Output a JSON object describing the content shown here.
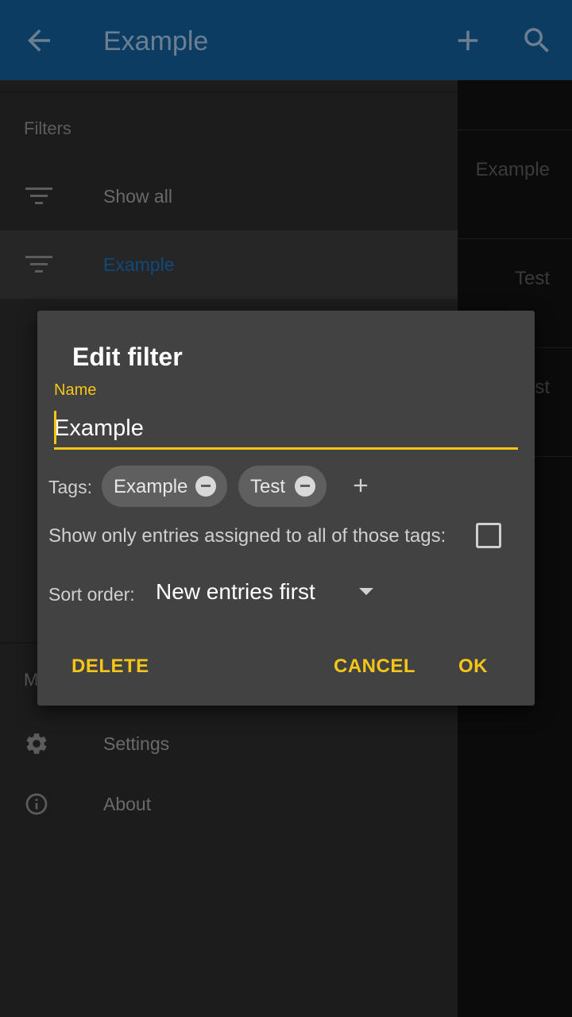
{
  "appbar": {
    "title": "Example",
    "back_icon": "arrow-back-icon",
    "add_icon": "plus-icon",
    "search_icon": "search-icon",
    "color": "#0d3c63"
  },
  "list": {
    "items": [
      "Example",
      "Test"
    ]
  },
  "drawer": {
    "filters_header": "Filters",
    "filters": [
      {
        "label": "Show all",
        "icon": "filter-icon"
      },
      {
        "label": "Example",
        "icon": "filter-icon",
        "active": true
      }
    ],
    "more_header": "M",
    "more": [
      {
        "label": "Settings",
        "icon": "gear-icon"
      },
      {
        "label": "About",
        "icon": "info-icon"
      }
    ]
  },
  "dialog": {
    "title": "Edit filter",
    "name_label": "Name",
    "name_value": "Example",
    "tags_label": "Tags:",
    "tags": [
      "Example",
      "Test"
    ],
    "show_only_label": "Show only entries assigned to all of those tags:",
    "show_only_checked": false,
    "sort_label": "Sort order:",
    "sort_value": "New entries first",
    "delete_label": "DELETE",
    "cancel_label": "CANCEL",
    "ok_label": "OK",
    "accent": "#f5c518"
  }
}
